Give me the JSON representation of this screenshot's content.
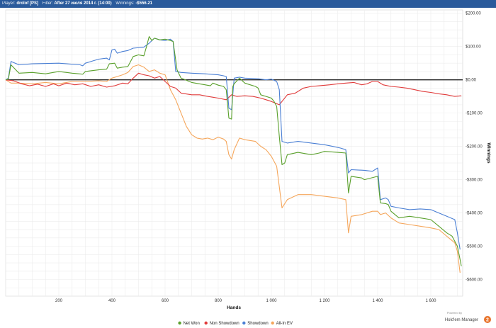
{
  "header": {
    "player_label": "Player:",
    "player_value": "drolof [PS]",
    "filter_label": "Filter:",
    "filter_value": "After 27 июля 2014 г. (14:00)",
    "winnings_label": "Winnings:",
    "winnings_value": "-$556.21"
  },
  "branding": {
    "powered_by": "Powered by",
    "name": "Hold'em Manager",
    "badge": "2"
  },
  "chart_data": {
    "type": "line",
    "xlabel": "Hands",
    "ylabel": "Winnings",
    "xlim": [
      0,
      1720
    ],
    "ylim": [
      -650,
      210
    ],
    "x_ticks": [
      {
        "v": 200,
        "label": "200"
      },
      {
        "v": 400,
        "label": "400"
      },
      {
        "v": 600,
        "label": "600"
      },
      {
        "v": 800,
        "label": "800"
      },
      {
        "v": 1000,
        "label": "1 000"
      },
      {
        "v": 1200,
        "label": "1 200"
      },
      {
        "v": 1400,
        "label": "1 400"
      },
      {
        "v": 1600,
        "label": "1 600"
      }
    ],
    "y_ticks": [
      {
        "v": 200,
        "label": "$200.00"
      },
      {
        "v": 100,
        "label": "$100.00"
      },
      {
        "v": 0,
        "label": "$0.00"
      },
      {
        "v": -100,
        "label": "-$100.00"
      },
      {
        "v": -200,
        "label": "-$200.00"
      },
      {
        "v": -300,
        "label": "-$300.00"
      },
      {
        "v": -400,
        "label": "-$400.00"
      },
      {
        "v": -500,
        "label": "-$500.00"
      },
      {
        "v": -600,
        "label": "-$600.00"
      }
    ],
    "grid": true,
    "legend_position": "bottom",
    "series": [
      {
        "name": "Net Won",
        "color": "#5aa02c",
        "points": [
          [
            0,
            0
          ],
          [
            10,
            2
          ],
          [
            20,
            45
          ],
          [
            50,
            20
          ],
          [
            100,
            22
          ],
          [
            150,
            18
          ],
          [
            200,
            25
          ],
          [
            250,
            20
          ],
          [
            290,
            17
          ],
          [
            300,
            25
          ],
          [
            350,
            30
          ],
          [
            380,
            32
          ],
          [
            390,
            48
          ],
          [
            410,
            50
          ],
          [
            420,
            35
          ],
          [
            440,
            38
          ],
          [
            460,
            40
          ],
          [
            480,
            70
          ],
          [
            500,
            75
          ],
          [
            520,
            72
          ],
          [
            530,
            100
          ],
          [
            540,
            130
          ],
          [
            550,
            118
          ],
          [
            560,
            125
          ],
          [
            580,
            120
          ],
          [
            600,
            122
          ],
          [
            620,
            118
          ],
          [
            630,
            115
          ],
          [
            645,
            30
          ],
          [
            660,
            5
          ],
          [
            700,
            -8
          ],
          [
            750,
            -15
          ],
          [
            770,
            -18
          ],
          [
            780,
            -10
          ],
          [
            800,
            -16
          ],
          [
            820,
            -20
          ],
          [
            830,
            -30
          ],
          [
            840,
            -115
          ],
          [
            850,
            -118
          ],
          [
            855,
            -20
          ],
          [
            860,
            -12
          ],
          [
            880,
            5
          ],
          [
            900,
            -10
          ],
          [
            920,
            -15
          ],
          [
            940,
            -20
          ],
          [
            950,
            -25
          ],
          [
            960,
            -45
          ],
          [
            980,
            -50
          ],
          [
            1000,
            -55
          ],
          [
            1010,
            -65
          ],
          [
            1020,
            -80
          ],
          [
            1030,
            -170
          ],
          [
            1040,
            -255
          ],
          [
            1050,
            -250
          ],
          [
            1060,
            -225
          ],
          [
            1100,
            -218
          ],
          [
            1150,
            -225
          ],
          [
            1180,
            -220
          ],
          [
            1200,
            -215
          ],
          [
            1250,
            -218
          ],
          [
            1280,
            -220
          ],
          [
            1290,
            -340
          ],
          [
            1300,
            -290
          ],
          [
            1340,
            -295
          ],
          [
            1350,
            -300
          ],
          [
            1400,
            -290
          ],
          [
            1410,
            -370
          ],
          [
            1430,
            -372
          ],
          [
            1440,
            -375
          ],
          [
            1450,
            -395
          ],
          [
            1480,
            -415
          ],
          [
            1520,
            -410
          ],
          [
            1560,
            -415
          ],
          [
            1600,
            -420
          ],
          [
            1630,
            -440
          ],
          [
            1660,
            -460
          ],
          [
            1680,
            -470
          ],
          [
            1700,
            -500
          ],
          [
            1710,
            -540
          ],
          [
            1715,
            -560
          ]
        ]
      },
      {
        "name": "Non Showdown",
        "color": "#e03a3a",
        "points": [
          [
            0,
            0
          ],
          [
            30,
            -3
          ],
          [
            60,
            -12
          ],
          [
            90,
            -18
          ],
          [
            120,
            -13
          ],
          [
            150,
            -20
          ],
          [
            180,
            -12
          ],
          [
            200,
            -18
          ],
          [
            230,
            -10
          ],
          [
            260,
            -15
          ],
          [
            290,
            -12
          ],
          [
            320,
            -20
          ],
          [
            350,
            -15
          ],
          [
            380,
            -22
          ],
          [
            410,
            -18
          ],
          [
            440,
            -10
          ],
          [
            460,
            -12
          ],
          [
            480,
            5
          ],
          [
            500,
            20
          ],
          [
            520,
            15
          ],
          [
            540,
            12
          ],
          [
            560,
            5
          ],
          [
            580,
            10
          ],
          [
            600,
            -5
          ],
          [
            620,
            -20
          ],
          [
            640,
            -25
          ],
          [
            660,
            -40
          ],
          [
            700,
            -45
          ],
          [
            730,
            -45
          ],
          [
            760,
            -50
          ],
          [
            800,
            -55
          ],
          [
            830,
            -60
          ],
          [
            850,
            -45
          ],
          [
            870,
            -50
          ],
          [
            900,
            -48
          ],
          [
            930,
            -50
          ],
          [
            960,
            -55
          ],
          [
            980,
            -60
          ],
          [
            1000,
            -65
          ],
          [
            1030,
            -75
          ],
          [
            1060,
            -45
          ],
          [
            1090,
            -40
          ],
          [
            1120,
            -25
          ],
          [
            1150,
            -20
          ],
          [
            1180,
            -18
          ],
          [
            1220,
            -15
          ],
          [
            1250,
            -12
          ],
          [
            1280,
            -10
          ],
          [
            1310,
            -8
          ],
          [
            1340,
            -15
          ],
          [
            1360,
            -12
          ],
          [
            1380,
            -5
          ],
          [
            1400,
            -5
          ],
          [
            1420,
            -15
          ],
          [
            1450,
            -20
          ],
          [
            1480,
            -22
          ],
          [
            1510,
            -25
          ],
          [
            1540,
            -30
          ],
          [
            1570,
            -35
          ],
          [
            1600,
            -38
          ],
          [
            1630,
            -42
          ],
          [
            1660,
            -45
          ],
          [
            1690,
            -50
          ],
          [
            1715,
            -48
          ]
        ]
      },
      {
        "name": "Showdown",
        "color": "#4a7fd4",
        "points": [
          [
            0,
            0
          ],
          [
            10,
            5
          ],
          [
            20,
            55
          ],
          [
            50,
            45
          ],
          [
            100,
            48
          ],
          [
            200,
            50
          ],
          [
            280,
            45
          ],
          [
            290,
            42
          ],
          [
            300,
            50
          ],
          [
            350,
            62
          ],
          [
            380,
            65
          ],
          [
            390,
            60
          ],
          [
            400,
            90
          ],
          [
            410,
            92
          ],
          [
            420,
            80
          ],
          [
            440,
            85
          ],
          [
            460,
            88
          ],
          [
            480,
            95
          ],
          [
            520,
            98
          ],
          [
            540,
            110
          ],
          [
            560,
            125
          ],
          [
            580,
            120
          ],
          [
            600,
            118
          ],
          [
            620,
            122
          ],
          [
            630,
            115
          ],
          [
            640,
            25
          ],
          [
            660,
            22
          ],
          [
            700,
            20
          ],
          [
            750,
            18
          ],
          [
            800,
            15
          ],
          [
            820,
            12
          ],
          [
            830,
            10
          ],
          [
            840,
            -85
          ],
          [
            850,
            -90
          ],
          [
            860,
            5
          ],
          [
            880,
            8
          ],
          [
            900,
            5
          ],
          [
            950,
            3
          ],
          [
            980,
            0
          ],
          [
            1000,
            2
          ],
          [
            1020,
            -5
          ],
          [
            1030,
            -30
          ],
          [
            1040,
            -185
          ],
          [
            1060,
            -190
          ],
          [
            1100,
            -185
          ],
          [
            1150,
            -190
          ],
          [
            1200,
            -195
          ],
          [
            1230,
            -200
          ],
          [
            1260,
            -205
          ],
          [
            1280,
            -210
          ],
          [
            1290,
            -280
          ],
          [
            1300,
            -270
          ],
          [
            1350,
            -272
          ],
          [
            1380,
            -275
          ],
          [
            1400,
            -265
          ],
          [
            1410,
            -360
          ],
          [
            1430,
            -355
          ],
          [
            1440,
            -360
          ],
          [
            1450,
            -380
          ],
          [
            1480,
            -385
          ],
          [
            1520,
            -390
          ],
          [
            1560,
            -388
          ],
          [
            1600,
            -390
          ],
          [
            1630,
            -400
          ],
          [
            1660,
            -410
          ],
          [
            1690,
            -420
          ],
          [
            1700,
            -460
          ],
          [
            1710,
            -510
          ]
        ]
      },
      {
        "name": "All-In EV",
        "color": "#f5a65b",
        "points": [
          [
            0,
            0
          ],
          [
            20,
            -10
          ],
          [
            50,
            -10
          ],
          [
            100,
            -12
          ],
          [
            150,
            -8
          ],
          [
            200,
            -12
          ],
          [
            250,
            -5
          ],
          [
            290,
            -5
          ],
          [
            300,
            -5
          ],
          [
            350,
            -3
          ],
          [
            380,
            -5
          ],
          [
            400,
            5
          ],
          [
            420,
            10
          ],
          [
            440,
            15
          ],
          [
            460,
            22
          ],
          [
            480,
            40
          ],
          [
            500,
            45
          ],
          [
            520,
            38
          ],
          [
            540,
            25
          ],
          [
            560,
            30
          ],
          [
            580,
            20
          ],
          [
            600,
            15
          ],
          [
            620,
            -30
          ],
          [
            640,
            -60
          ],
          [
            660,
            -100
          ],
          [
            680,
            -140
          ],
          [
            700,
            -165
          ],
          [
            720,
            -175
          ],
          [
            740,
            -178
          ],
          [
            760,
            -175
          ],
          [
            780,
            -180
          ],
          [
            800,
            -172
          ],
          [
            820,
            -178
          ],
          [
            830,
            -185
          ],
          [
            840,
            -225
          ],
          [
            850,
            -238
          ],
          [
            860,
            -210
          ],
          [
            880,
            -175
          ],
          [
            900,
            -180
          ],
          [
            940,
            -185
          ],
          [
            960,
            -200
          ],
          [
            980,
            -210
          ],
          [
            1000,
            -230
          ],
          [
            1020,
            -260
          ],
          [
            1040,
            -385
          ],
          [
            1060,
            -360
          ],
          [
            1100,
            -345
          ],
          [
            1150,
            -345
          ],
          [
            1200,
            -350
          ],
          [
            1250,
            -355
          ],
          [
            1280,
            -360
          ],
          [
            1290,
            -460
          ],
          [
            1300,
            -410
          ],
          [
            1340,
            -405
          ],
          [
            1380,
            -395
          ],
          [
            1400,
            -395
          ],
          [
            1410,
            -405
          ],
          [
            1430,
            -400
          ],
          [
            1450,
            -415
          ],
          [
            1480,
            -430
          ],
          [
            1520,
            -435
          ],
          [
            1560,
            -440
          ],
          [
            1600,
            -445
          ],
          [
            1630,
            -450
          ],
          [
            1660,
            -470
          ],
          [
            1690,
            -490
          ],
          [
            1700,
            -515
          ],
          [
            1710,
            -580
          ]
        ]
      }
    ]
  }
}
